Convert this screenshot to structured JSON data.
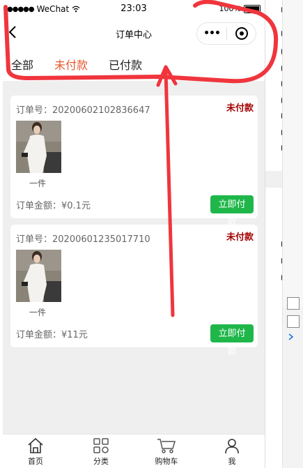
{
  "status_bar": {
    "carrier": "WeChat",
    "time": "23:03",
    "battery": "100%"
  },
  "nav": {
    "back_icon": "chevron-left-icon",
    "title": "订单中心",
    "more_glyph": "•••",
    "close_icon": "target-icon"
  },
  "tabs": [
    {
      "label": "全部",
      "active": false
    },
    {
      "label": "未付款",
      "active": true
    },
    {
      "label": "已付款",
      "active": false
    }
  ],
  "orders": [
    {
      "order_no": "订单号：20200602102836647",
      "status": "未付款",
      "qty": "一件",
      "amount": "订单金额：¥0.1元",
      "pay_label": "立即付款"
    },
    {
      "order_no": "订单号：20200601235017710",
      "status": "未付款",
      "qty": "一件",
      "amount": "订单金额：¥11元",
      "pay_label": "立即付款"
    }
  ],
  "tabbar": [
    {
      "label": "首页",
      "icon": "home-icon"
    },
    {
      "label": "分类",
      "icon": "category-grid-icon"
    },
    {
      "label": "购物车",
      "icon": "cart-icon"
    },
    {
      "label": "我",
      "icon": "user-icon"
    }
  ],
  "colors": {
    "accent_tab": "#e5582e",
    "status_text": "#a50000",
    "pay_button": "#1fb74a",
    "annotation": "#f0353d"
  }
}
